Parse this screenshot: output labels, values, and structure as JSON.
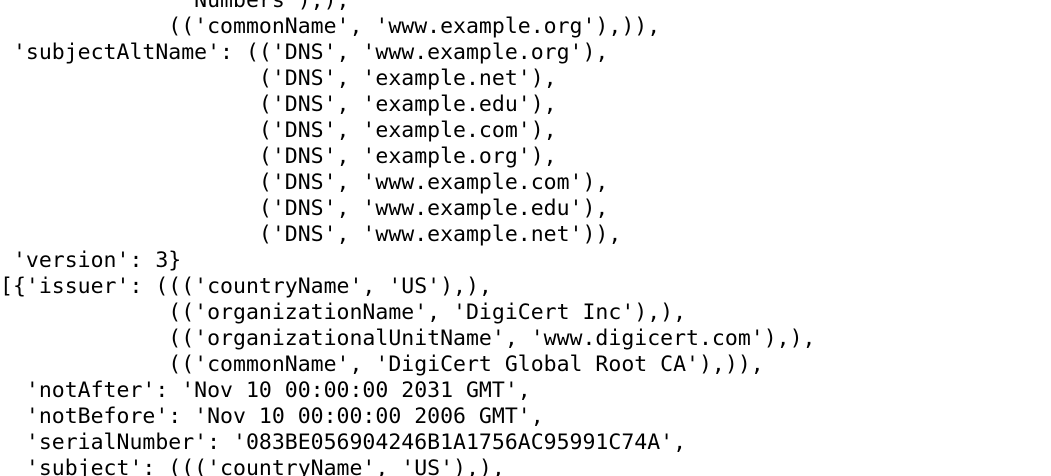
{
  "terminal": {
    "lines": [
      "              'Numbers'),),",
      "             (('commonName', 'www.example.org'),)),",
      " 'subjectAltName': (('DNS', 'www.example.org'),",
      "                    ('DNS', 'example.net'),",
      "                    ('DNS', 'example.edu'),",
      "                    ('DNS', 'example.com'),",
      "                    ('DNS', 'example.org'),",
      "                    ('DNS', 'www.example.com'),",
      "                    ('DNS', 'www.example.edu'),",
      "                    ('DNS', 'www.example.net')),",
      " 'version': 3}",
      "[{'issuer': ((('countryName', 'US'),),",
      "             (('organizationName', 'DigiCert Inc'),),",
      "             (('organizationalUnitName', 'www.digicert.com'),),",
      "             (('commonName', 'DigiCert Global Root CA'),)),",
      "  'notAfter': 'Nov 10 00:00:00 2031 GMT',",
      "  'notBefore': 'Nov 10 00:00:00 2006 GMT',",
      "  'serialNumber': '083BE056904246B1A1756AC95991C74A',",
      "  'subject': ((('countryName', 'US'),),"
    ]
  }
}
